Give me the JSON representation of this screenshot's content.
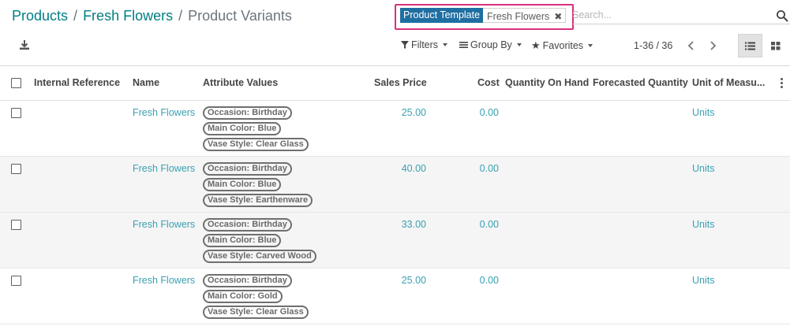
{
  "breadcrumb": {
    "items": [
      {
        "label": "Products"
      },
      {
        "label": "Fresh Flowers"
      }
    ],
    "separator": "/",
    "current": "Product Variants"
  },
  "search": {
    "facet_label": "Product Template",
    "facet_value": "Fresh Flowers",
    "facet_remove_icon": "close-icon",
    "placeholder": "Search...",
    "icon": "search-icon",
    "highlight_color": "#d6317d"
  },
  "toolbar": {
    "download_icon": "download-icon",
    "filters_label": "Filters",
    "group_by_label": "Group By",
    "favorites_label": "Favorites"
  },
  "pager": {
    "value": "1-36 / 36"
  },
  "views": {
    "active": "list",
    "list_icon": "list-view-icon",
    "kanban_icon": "kanban-view-icon"
  },
  "columns": [
    "Internal Reference",
    "Name",
    "Attribute Values",
    "Sales Price",
    "Cost",
    "Quantity On Hand",
    "Forecasted Quantity",
    "Unit of Measu..."
  ],
  "rows": [
    {
      "internal_reference": "",
      "name": "Fresh Flowers",
      "attributes": [
        "Occasion: Birthday",
        "Main Color: Blue",
        "Vase Style: Clear Glass"
      ],
      "sales_price": "25.00",
      "cost": "0.00",
      "qty_on_hand": "",
      "forecasted_qty": "",
      "uom": "Units"
    },
    {
      "internal_reference": "",
      "name": "Fresh Flowers",
      "attributes": [
        "Occasion: Birthday",
        "Main Color: Blue",
        "Vase Style: Earthenware"
      ],
      "sales_price": "40.00",
      "cost": "0.00",
      "qty_on_hand": "",
      "forecasted_qty": "",
      "uom": "Units"
    },
    {
      "internal_reference": "",
      "name": "Fresh Flowers",
      "attributes": [
        "Occasion: Birthday",
        "Main Color: Blue",
        "Vase Style: Carved Wood"
      ],
      "sales_price": "33.00",
      "cost": "0.00",
      "qty_on_hand": "",
      "forecasted_qty": "",
      "uom": "Units"
    },
    {
      "internal_reference": "",
      "name": "Fresh Flowers",
      "attributes": [
        "Occasion: Birthday",
        "Main Color: Gold",
        "Vase Style: Clear Glass"
      ],
      "sales_price": "25.00",
      "cost": "0.00",
      "qty_on_hand": "",
      "forecasted_qty": "",
      "uom": "Units"
    }
  ],
  "colors": {
    "link": "#017e84",
    "value_link": "#3aa1b3",
    "facet_bg": "#1f6ea1",
    "row_alt_bg": "#f5f5f5"
  }
}
